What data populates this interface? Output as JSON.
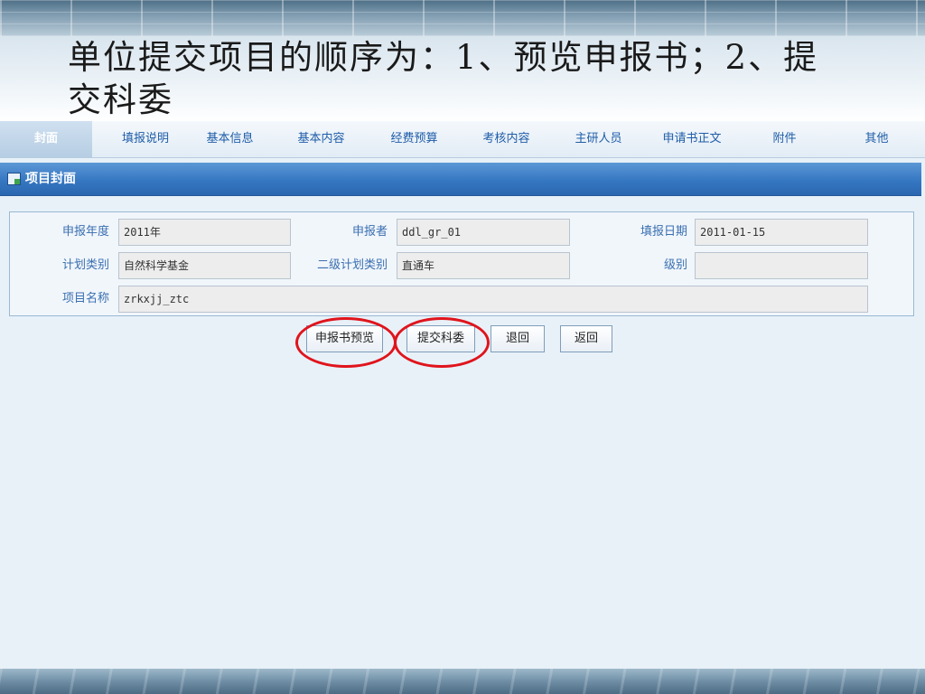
{
  "slide": {
    "title_line1": "单位提交项目的顺序为：1、预览申报书；2、提",
    "title_line2": "交科委"
  },
  "tabs": [
    {
      "label": "封面",
      "active": true
    },
    {
      "label": "填报说明"
    },
    {
      "label": "基本信息"
    },
    {
      "label": "基本内容"
    },
    {
      "label": "经费预算"
    },
    {
      "label": "考核内容"
    },
    {
      "label": "主研人员"
    },
    {
      "label": "申请书正文"
    },
    {
      "label": "附件"
    },
    {
      "label": "其他"
    }
  ],
  "section": {
    "icon": "form-icon",
    "title": "项目封面"
  },
  "form": {
    "year_label": "申报年度",
    "year_value": "2011年",
    "applicant_label": "申报者",
    "applicant_value": "ddl_gr_01",
    "date_label": "填报日期",
    "date_value": "2011-01-15",
    "plan_label": "计划类别",
    "plan_value": "自然科学基金",
    "subplan_label": "二级计划类别",
    "subplan_value": "直通车",
    "level_label": "级别",
    "level_value": "",
    "name_label": "项目名称",
    "name_value": "zrkxjj_ztc"
  },
  "buttons": {
    "preview": "申报书预览",
    "submit": "提交科委",
    "reject": "退回",
    "back": "返回"
  },
  "colors": {
    "highlight": "#e0141c",
    "accent": "#3677c2"
  }
}
